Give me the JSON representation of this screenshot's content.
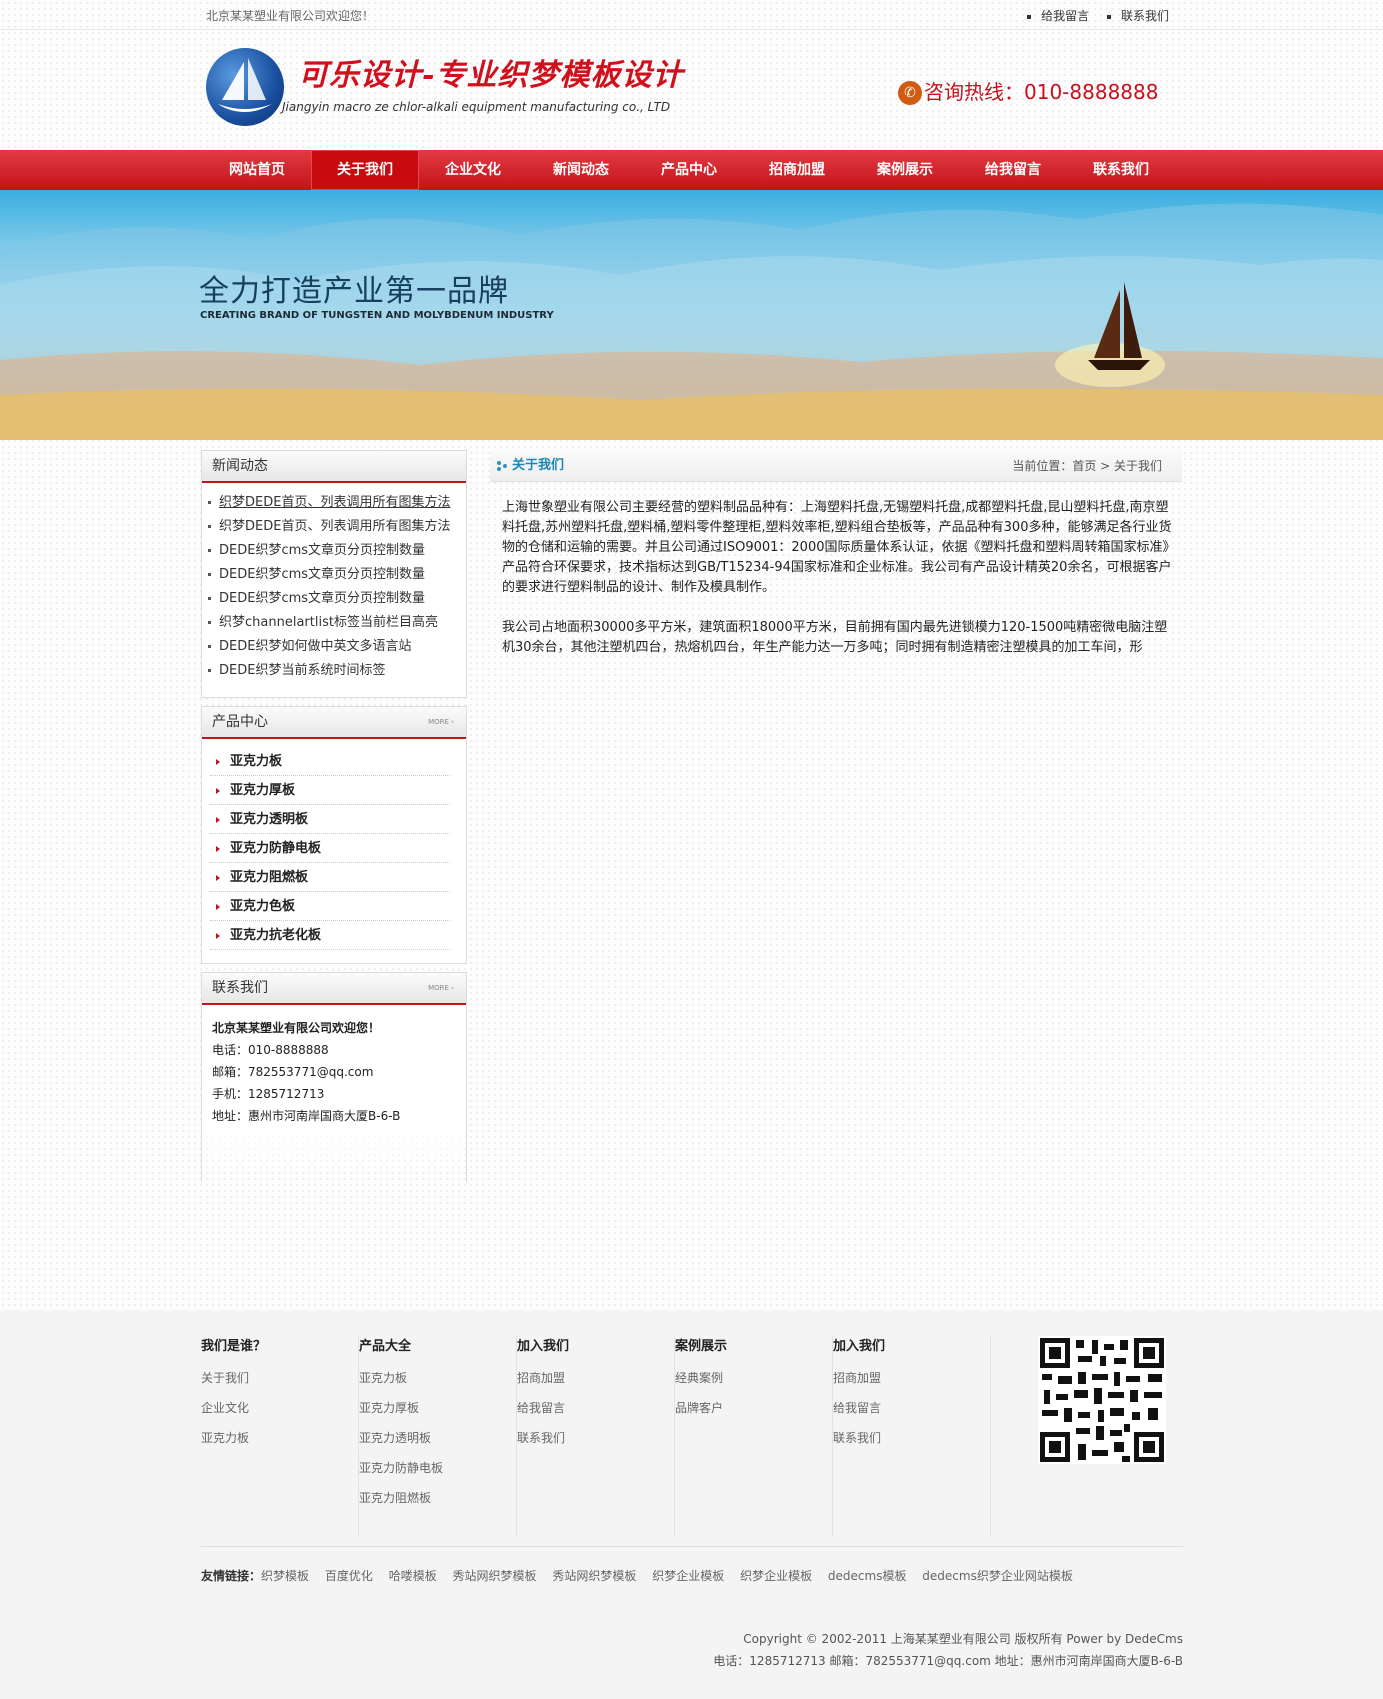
{
  "topbar": {
    "welcome": "北京某某塑业有限公司欢迎您！",
    "links": [
      "给我留言",
      "联系我们"
    ]
  },
  "header": {
    "logo_title": "可乐设计-专业织梦模板设计",
    "logo_subtitle": "Jiangyin macro ze chlor-alkali equipment manufacturing co., LTD",
    "hotline": "咨询热线：010-8888888"
  },
  "nav": {
    "items": [
      "网站首页",
      "关于我们",
      "企业文化",
      "新闻动态",
      "产品中心",
      "招商加盟",
      "案例展示",
      "给我留言",
      "联系我们"
    ],
    "active": "关于我们"
  },
  "banner": {
    "title": "全力打造产业第一品牌",
    "subtitle": "CREATING BRAND OF TUNGSTEN AND MOLYBDENUM INDUSTRY"
  },
  "sidebar": {
    "news": {
      "title": "新闻动态",
      "items": [
        "织梦DEDE首页、列表调用所有图集方法",
        "织梦DEDE首页、列表调用所有图集方法",
        "DEDE织梦cms文章页分页控制数量",
        "DEDE织梦cms文章页分页控制数量",
        "DEDE织梦cms文章页分页控制数量",
        "织梦channelartlist标签当前栏目高亮",
        "DEDE织梦如何做中英文多语言站",
        "DEDE织梦当前系统时间标签"
      ]
    },
    "products": {
      "title": "产品中心",
      "more": "MORE ›",
      "items": [
        "亚克力板",
        "亚克力厚板",
        "亚克力透明板",
        "亚克力防静电板",
        "亚克力阻燃板",
        "亚克力色板",
        "亚克力抗老化板"
      ]
    },
    "contact": {
      "title": "联系我们",
      "more": "MORE ›",
      "lines": [
        "北京某某塑业有限公司欢迎您！",
        "电话：010-8888888",
        "邮箱：782553771@qq.com",
        "手机：1285712713",
        "地址：惠州市河南岸国商大厦B-6-B"
      ]
    }
  },
  "main": {
    "title": "关于我们",
    "breadcrumb": "当前位置：首页 > 关于我们",
    "paragraphs": [
      "上海世象塑业有限公司主要经营的塑料制品品种有：上海塑料托盘,无锡塑料托盘,成都塑料托盘,昆山塑料托盘,南京塑料托盘,苏州塑料托盘,塑料桶,塑料零件整理柜,塑料效率柜,塑料组合垫板等，产品品种有300多种，能够满足各行业货物的仓储和运输的需要。并且公司通过ISO9001：2000国际质量体系认证，依据《塑料托盘和塑料周转箱国家标准》产品符合环保要求，技术指标达到GB/T15234-94国家标准和企业标准。我公司有产品设计精英20余名，可根据客户的要求进行塑料制品的设计、制作及模具制作。",
      "我公司占地面积30000多平方米，建筑面积18000平方米，目前拥有国内最先进锁模力120-1500吨精密微电脑注塑机30余台，其他注塑机四台，热熔机四台，年生产能力达一万多吨；同时拥有制造精密注塑模具的加工车间，形"
    ]
  },
  "footer": {
    "columns": [
      {
        "title": "我们是谁？",
        "items": [
          "关于我们",
          "企业文化",
          "亚克力板"
        ]
      },
      {
        "title": "产品大全",
        "items": [
          "亚克力板",
          "亚克力厚板",
          "亚克力透明板",
          "亚克力防静电板",
          "亚克力阻燃板"
        ]
      },
      {
        "title": "加入我们",
        "items": [
          "招商加盟",
          "给我留言",
          "联系我们"
        ]
      },
      {
        "title": "案例展示",
        "items": [
          "经典案例",
          "品牌客户"
        ]
      },
      {
        "title": "加入我们",
        "items": [
          "招商加盟",
          "给我留言",
          "联系我们"
        ]
      }
    ],
    "friend_links_label": "友情链接：",
    "friend_links": [
      "织梦模板",
      "百度优化",
      "哈喽模板",
      "秀站网织梦模板",
      "秀站网织梦模板",
      "织梦企业模板",
      "织梦企业模板",
      "dedecms模板",
      "dedecms织梦企业网站模板"
    ],
    "copyright": "Copyright © 2002-2011 上海某某塑业有限公司 版权所有 Power by DedeCms",
    "contact_line": "电话：1285712713 邮箱：782553771@qq.com 地址：惠州市河南岸国商大厦B-6-B"
  }
}
